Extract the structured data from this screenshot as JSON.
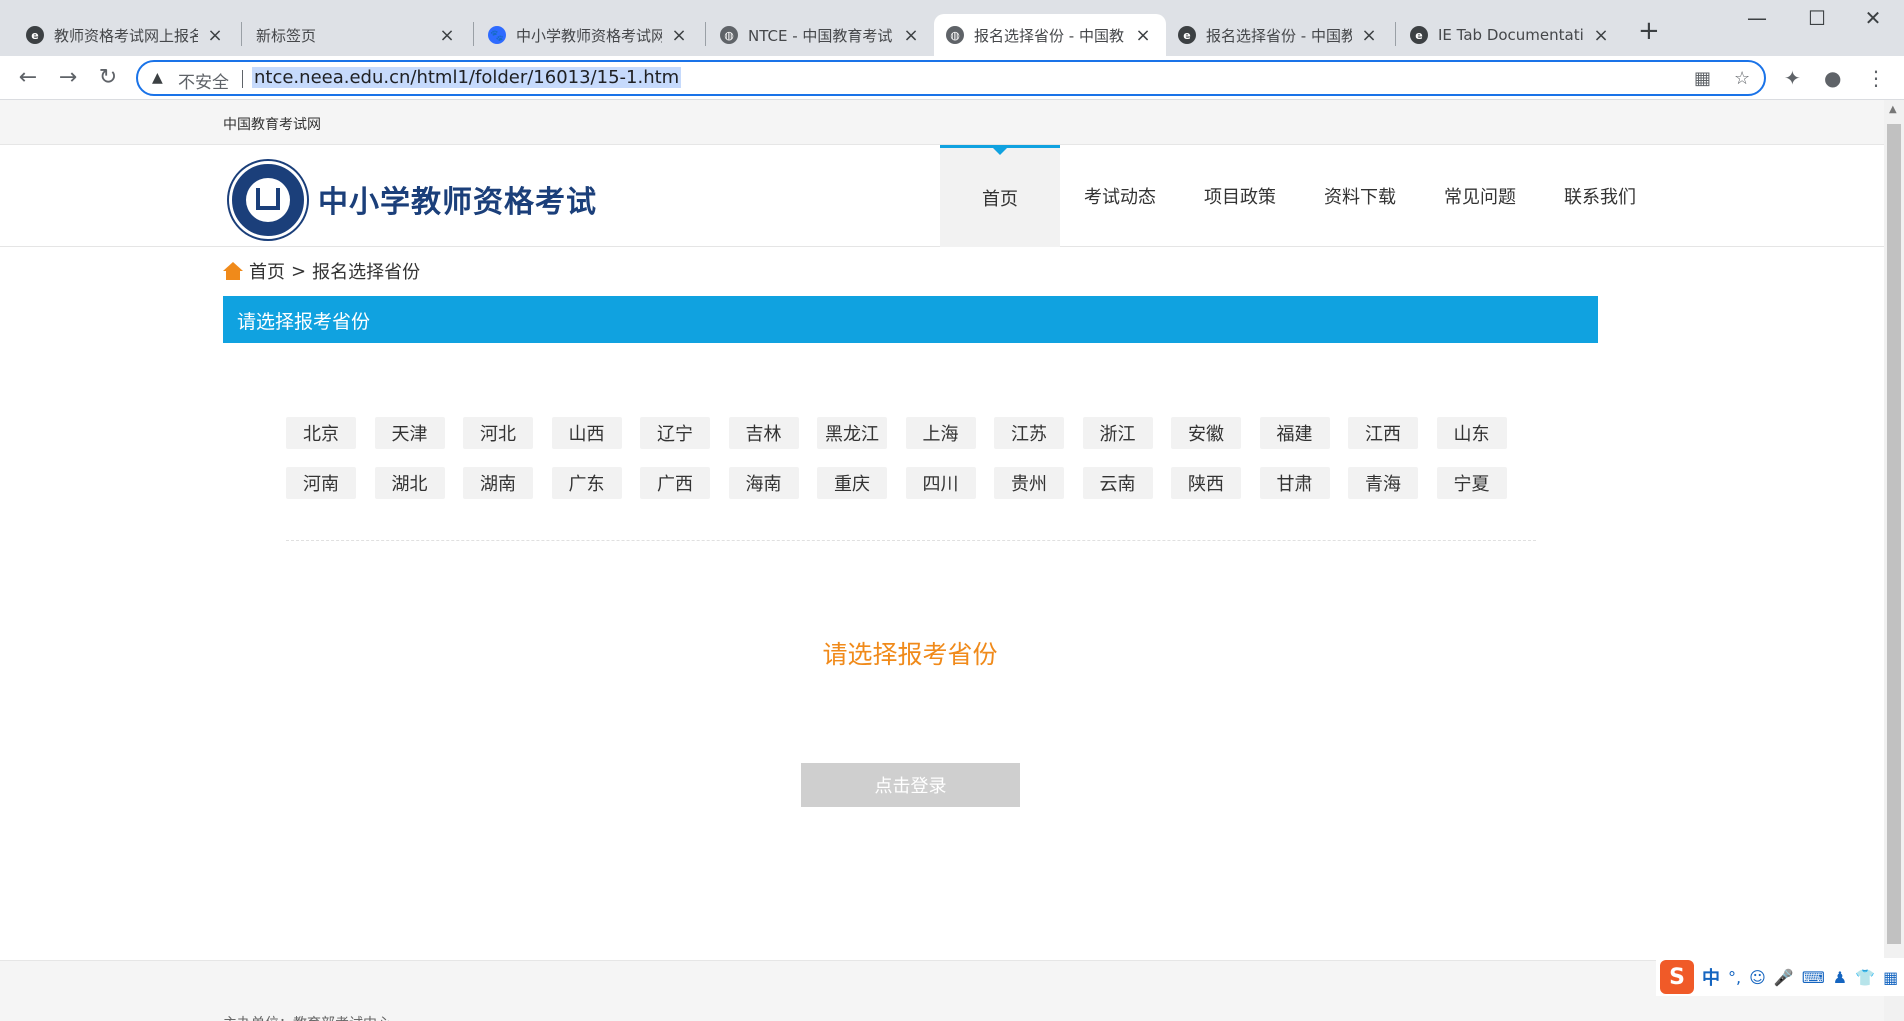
{
  "browser": {
    "tabs": [
      {
        "title": "教师资格考试网上报名",
        "icon": "ie-icon",
        "active": false
      },
      {
        "title": "新标签页",
        "icon": "none",
        "active": false
      },
      {
        "title": "中小学教师资格考试网",
        "icon": "baidu-paw-icon",
        "active": false
      },
      {
        "title": "NTCE - 中国教育考试",
        "icon": "globe-icon",
        "active": false
      },
      {
        "title": "报名选择省份 - 中国教",
        "icon": "globe-icon",
        "active": true
      },
      {
        "title": "报名选择省份 - 中国教",
        "icon": "ie-icon",
        "active": false
      },
      {
        "title": "IE Tab Documentatio",
        "icon": "ie-icon",
        "active": false
      }
    ],
    "address": {
      "security_label": "不安全",
      "url": "ntce.neea.edu.cn/html1/folder/16013/15-1.htm"
    }
  },
  "site": {
    "top_strip": "中国教育考试网",
    "logo_text": "中小学教师资格考试",
    "nav": [
      {
        "label": "首页",
        "active": true
      },
      {
        "label": "考试动态",
        "active": false
      },
      {
        "label": "项目政策",
        "active": false
      },
      {
        "label": "资料下载",
        "active": false
      },
      {
        "label": "常见问题",
        "active": false
      },
      {
        "label": "联系我们",
        "active": false
      }
    ],
    "breadcrumb": {
      "home": "首页",
      "separator": ">",
      "current": "报名选择省份"
    },
    "section_title": "请选择报考省份",
    "provinces_row1": [
      "北京",
      "天津",
      "河北",
      "山西",
      "辽宁",
      "吉林",
      "黑龙江",
      "上海",
      "江苏",
      "浙江",
      "安徽",
      "福建",
      "江西",
      "山东"
    ],
    "provinces_row2": [
      "河南",
      "湖北",
      "湖南",
      "广东",
      "广西",
      "海南",
      "重庆",
      "四川",
      "贵州",
      "云南",
      "陕西",
      "甘肃",
      "青海",
      "宁夏"
    ],
    "prompt": "请选择报考省份",
    "login_button": "点击登录",
    "footer_text": "主办单位：教育部考试中心"
  },
  "ime": {
    "mode": "中",
    "punct": "°,"
  },
  "colors": {
    "accent_blue": "#10a2e0",
    "accent_orange": "#f08a1a",
    "logo_navy": "#1b3f7a",
    "login_disabled": "#cfcfcf"
  }
}
